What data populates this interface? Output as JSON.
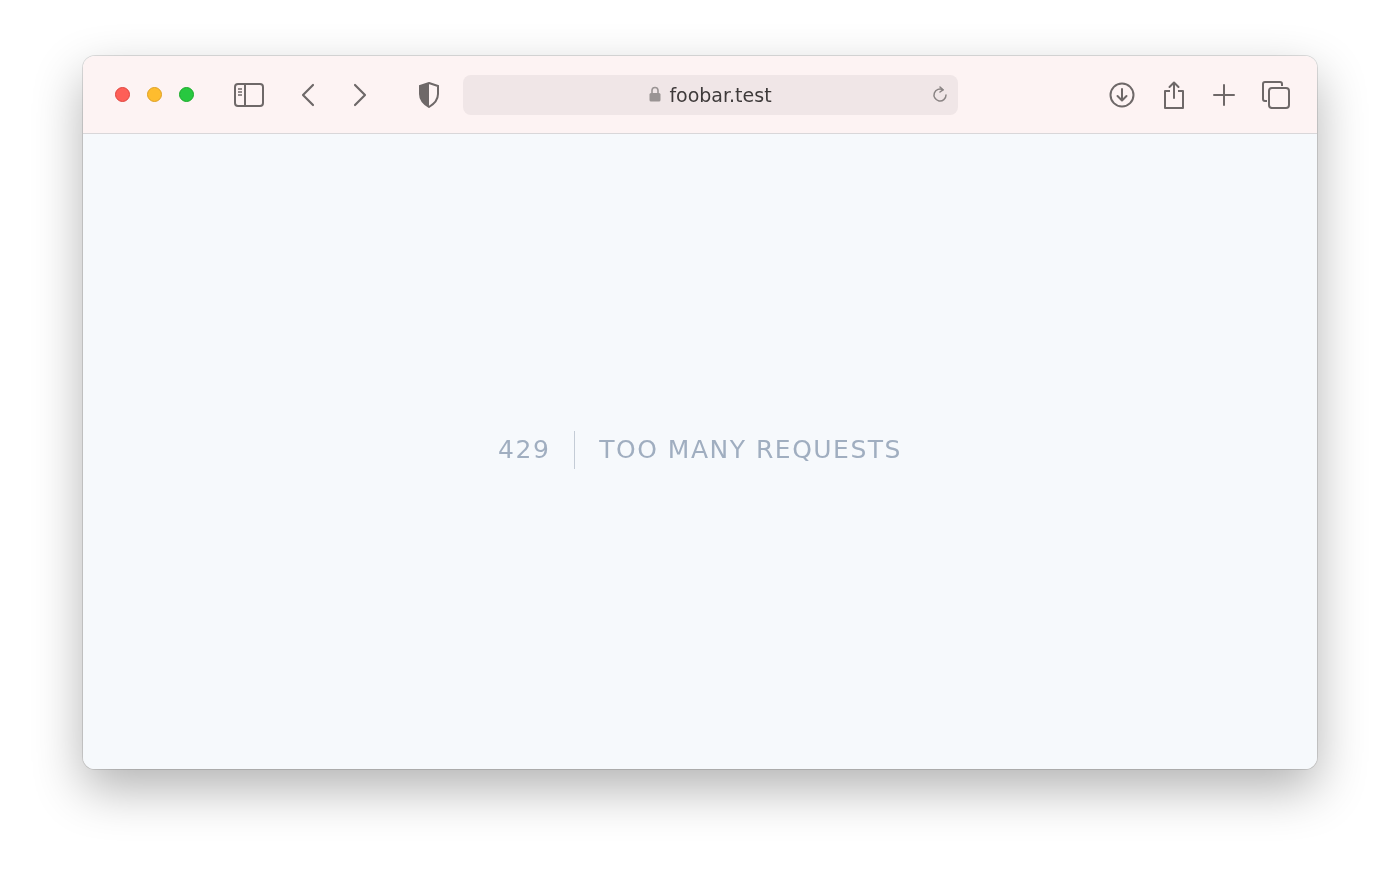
{
  "address_bar": {
    "url": "foobar.test",
    "secure": true
  },
  "error": {
    "code": "429",
    "message": "TOO MANY REQUESTS"
  }
}
